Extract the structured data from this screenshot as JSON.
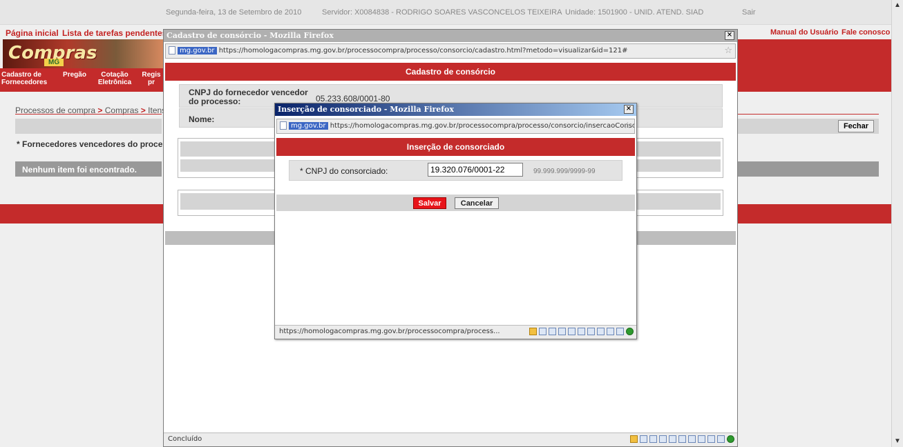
{
  "topbar": {
    "date": "Segunda-feira, 13 de Setembro de 2010",
    "server": "Servidor: X0084838 - RODRIGO SOARES VASCONCELOS TEIXEIRA",
    "unit": "Unidade: 1501900 - UNID. ATEND. SIAD",
    "logout": "Sair"
  },
  "nav": {
    "home": "Página inicial",
    "tasks": "Lista de tarefas pendentes",
    "manual": "Manual do Usuário",
    "contact": "Fale conosco"
  },
  "logo": {
    "word": "Compras",
    "sub": "MG"
  },
  "menu": [
    {
      "line1": "Cadastro de",
      "line2": "Fornecedores"
    },
    {
      "line1": "Pregão",
      "line2": ""
    },
    {
      "line1": "Cotação",
      "line2": "Eletrônica"
    },
    {
      "line1": "Regis",
      "line2": "pr"
    }
  ],
  "main": {
    "breadcrumb_1": "Processos de compra",
    "breadcrumb_sep": ">",
    "breadcrumb_2": "Compras",
    "breadcrumb_3": "Itens I",
    "fechar": "Fechar",
    "vencedores": "* Fornecedores vencedores do processo",
    "nenhum": "Nenhum item foi encontrado."
  },
  "window1": {
    "title": "Cadastro de consórcio - Mozilla Firefox",
    "url_domain": "mg.gov.br",
    "url": "https://homologacompras.mg.gov.br/processocompra/processo/consorcio/cadastro.html?metodo=visualizar&id=121#",
    "header": "Cadastro de consórcio",
    "cnpj_label": "CNPJ do fornecedor vencedor do processo:",
    "cnpj_value": "05.233.608/0001-80",
    "nome_label": "Nome:",
    "status": "Concluído"
  },
  "window2": {
    "title": "Inserção de consorciado - Mozilla Firefox",
    "url_domain": "mg.gov.br",
    "url": "https://homologacompras.mg.gov.br/processocompra/processo/consorcio/insercaoConsorciado.",
    "header": "Inserção de consorciado",
    "field_label": "* CNPJ do consorciado:",
    "field_value": "19.320.076/0001-22",
    "field_mask": "99.999.999/9999-99",
    "save": "Salvar",
    "cancel": "Cancelar",
    "status": "https://homologacompras.mg.gov.br/processocompra/process..."
  },
  "colors": {
    "brand_red": "#c42b2b",
    "save_red": "#e8141a",
    "title_blue": "#0a246a"
  }
}
